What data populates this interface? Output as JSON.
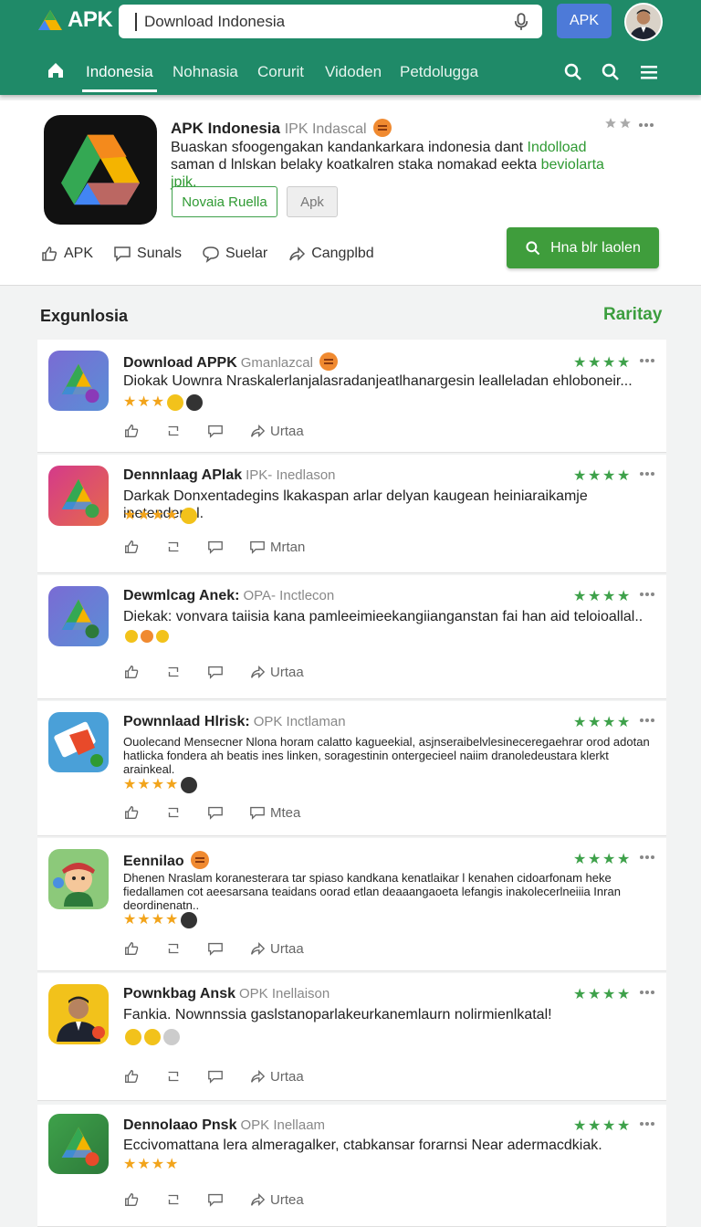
{
  "header": {
    "logo_text": "APK",
    "search_value": "Download Indonesia",
    "apk_button": "APK",
    "colors": {
      "bar": "#1f8a68",
      "apk_button": "#4d7ad8",
      "accent_green": "#3f9d3c"
    }
  },
  "nav": {
    "tabs": [
      "Indonesia",
      "Nohnasia",
      "Corurit",
      "Vidoden",
      "Petdolugga"
    ],
    "active_tab": "Indonesia"
  },
  "featured": {
    "title": "APK Indonesia",
    "subtitle": "IPK Indascal",
    "desc_line1_text": "Buaskan sfoogengakan kandankarkara indonesia dant ",
    "desc_line1_hl": "Indolload",
    "desc_line2_text": "saman d lnlskan belaky koatkalren staka nomakad eekta ",
    "desc_line2_hl": "beviolarta jpik.",
    "button_outline": "Novaia Ruella",
    "button_grey": "Apk",
    "actions": [
      "APK",
      "Sunals",
      "Suelar",
      "Cangplbd"
    ],
    "green_button": "Hna blr laolen"
  },
  "section": {
    "title": "Exgunlosia",
    "link": "Raritay"
  },
  "items": [
    {
      "title": "Download APPK",
      "subtitle": "Gmanlazcal",
      "desc": "Diokak Uownra Nraskalerlanjalasradanjeatlhanargesin lealleladan ehloboneir...",
      "stars": 3,
      "action": "Urtaa",
      "rating": 4
    },
    {
      "title": "Dennnlaag APlak",
      "subtitle": "IPK- Inedlason",
      "desc": "Darkak Donxentadegins lkakaspan arlar delyan kaugean heiniaraikamje inetendertal.",
      "stars": 4,
      "action": "Mrtan",
      "rating": 4
    },
    {
      "title": "Dewmlcag Anek:",
      "subtitle": "OPA- Inctlecon",
      "desc": "Diekak: vonvara taiisia kana pamleeimieekangiianganstan fai han aid teloioallal..",
      "stars": 0,
      "action": "Urtaa",
      "rating": 4
    },
    {
      "title": "Pownnlaad Hlrisk:",
      "subtitle": "OPK Inctlaman",
      "desc": "Ouolecand Mensecner Nlona horam calatto kagueekial, asjnseraibelvlesineceregaehrar orod adotan hatlicka fondera ah beatis ines linken, soragestinin ontergecieel naiim dranoledeustara klerkt arainkeal.",
      "stars": 4,
      "action": "Mtea",
      "rating": 4
    },
    {
      "title": "Eennilao",
      "subtitle": "",
      "desc": "Dhenen Nraslam koranesterara tar spiaso kandkana kenatlaikar l kenahen cidoarfonam heke fiedallamen cot aeesarsana teaidans oorad etlan deaaangaoeta lefangis inakolecerlneiiia Inran deordinenatn..",
      "stars": 4,
      "action": "Urtaa",
      "rating": 4
    },
    {
      "title": "Pownkbag Ansk",
      "subtitle": "OPK Inellaison",
      "desc": "Fankia. Nownnssia gaslstanoparlakeurkanemlaurn nolirmienlkatal!",
      "stars": 0,
      "action": "Urtaa",
      "rating": 4
    },
    {
      "title": "Dennolaao Pnsk",
      "subtitle": "OPK Inellaam",
      "desc": "Eccivomattana lera almeragalker, ctabkansar forarnsi Near adermacdkiak.",
      "stars": 4,
      "action": "Urtea",
      "rating": 4
    }
  ]
}
